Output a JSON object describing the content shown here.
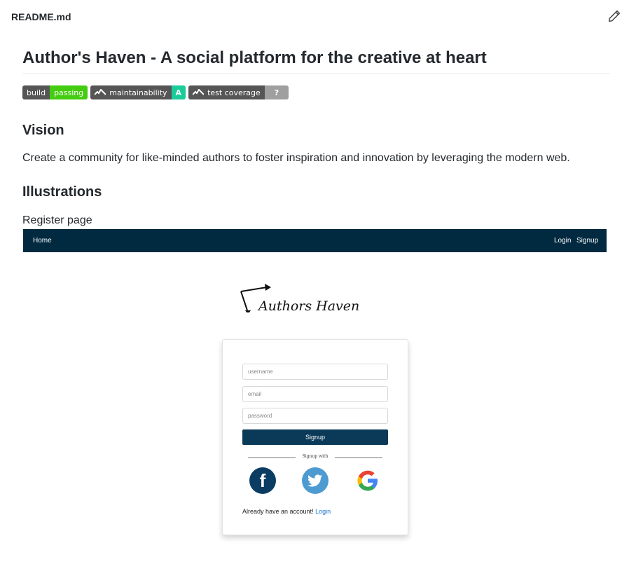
{
  "file": {
    "name": "README.md",
    "edit_icon": "pencil-icon"
  },
  "readme": {
    "title": "Author's Haven - A social platform for the creative at heart",
    "badges": [
      {
        "label": "build",
        "value": "passing",
        "color": "#44cc11"
      },
      {
        "label": "maintainability",
        "value": "A",
        "color": "#1acc99"
      },
      {
        "label": "test coverage",
        "value": "?",
        "color": "#9f9f9f"
      }
    ],
    "vision_heading": "Vision",
    "vision_text": "Create a community for like-minded authors to foster inspiration and innovation by leveraging the modern web.",
    "illustrations_heading": "Illustrations",
    "register_caption": "Register page"
  },
  "screenshot": {
    "navbar": {
      "home": "Home",
      "login": "Login",
      "signup": "Signup",
      "color": "#012a40"
    },
    "logo_text": "Authors Haven",
    "form": {
      "username_placeholder": "username",
      "email_placeholder": "email",
      "password_placeholder": "password",
      "signup_button": "Signup",
      "signup_with": "Signup with",
      "already_text": "Already have an account!",
      "login_link": "Login"
    },
    "social_icons": [
      "facebook-icon",
      "twitter-icon",
      "google-icon"
    ]
  }
}
